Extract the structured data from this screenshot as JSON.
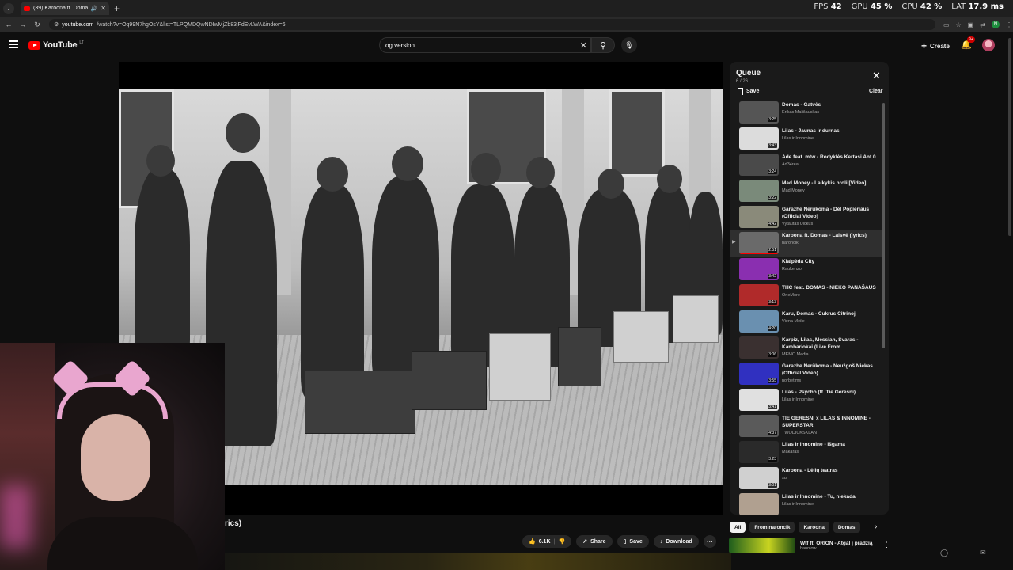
{
  "browser": {
    "tab_title": "(39) Karoona ft. Domas - Laisvė",
    "url_host": "youtube.com",
    "url_path": "/watch?v=Oq99N7hgOsY&list=TLPQMDQwNDIwMjZb83jFdEvLWA&index=6",
    "new_tab": "+"
  },
  "stats": {
    "fps_label": "FPS",
    "fps_value": "42",
    "gpu_label": "GPU",
    "gpu_value": "45 %",
    "cpu_label": "CPU",
    "cpu_value": "42 %",
    "lat_label": "LAT",
    "lat_value": "17.9 ms"
  },
  "youtube": {
    "logo_text": "YouTube",
    "region": "LT",
    "search_value": "og version",
    "create_label": "Create",
    "notifications_badge": "9+"
  },
  "video": {
    "title_fragment": "rics)"
  },
  "actions": {
    "like_count": "6.1K",
    "share_label": "Share",
    "save_label": "Save",
    "download_label": "Download"
  },
  "queue": {
    "title": "Queue",
    "position": "6 / 26",
    "save_label": "Save",
    "clear_label": "Clear",
    "items": [
      {
        "title": "Domas - Gatvės",
        "channel": "Erikas Mališauskas",
        "duration": "3:25",
        "thumb": "#555555",
        "progress": 0
      },
      {
        "title": "Lilas - Jaunas ir durnas",
        "channel": "Lilas ir Innomine",
        "duration": "3:43",
        "thumb": "#dcdcdc",
        "progress": 0
      },
      {
        "title": "Ade feat. mtw - Rodyklės Kertasi Ant 0",
        "channel": "Ad34real",
        "duration": "3:24",
        "thumb": "#4a4a4a",
        "progress": 0
      },
      {
        "title": "Mad Money - Laikykis broli [Video]",
        "channel": "Mad Money",
        "duration": "3:22",
        "thumb": "#7a8a7a",
        "progress": 0
      },
      {
        "title": "Garazhe Nerūkoma - Dėl Popieriaus (Official Video)",
        "channel": "Vytautas Ulckus",
        "duration": "4:42",
        "thumb": "#8a8a7a",
        "progress": 0
      },
      {
        "title": "Karoona ft. Domas - Laisvė (lyrics)",
        "channel": "naroncik",
        "duration": "2:51",
        "thumb": "#6a6a6a",
        "progress": 1
      },
      {
        "title": "Klaipėda City",
        "channel": "Raukenzo",
        "duration": "3:42",
        "thumb": "#8a2fb0",
        "progress": 0
      },
      {
        "title": "THC feat. DOMAS - NIEKO PANAŠAUS",
        "channel": "OneMore",
        "duration": "3:13",
        "thumb": "#b02a2a",
        "progress": 0
      },
      {
        "title": "Karu, Domas - Cukrus Citrinoj",
        "channel": "Viena Meile",
        "duration": "4:20",
        "thumb": "#6a90b0",
        "progress": 0
      },
      {
        "title": "Karpiz, Lilas, Messiah, Svaras - Kambariokai (Live From...",
        "channel": "MEMO Media",
        "duration": "3:06",
        "thumb": "#3a3030",
        "progress": 0
      },
      {
        "title": "Garazhe Nerūkoma - Neužgoš Niekas (Official Video)",
        "channel": "norbetims",
        "duration": "3:55",
        "thumb": "#3030c0",
        "progress": 0
      },
      {
        "title": "Lilas - Psycho (ft. Tie Geresni)",
        "channel": "Lilas ir Innomine",
        "duration": "3:41",
        "thumb": "#e0e0e0",
        "progress": 0
      },
      {
        "title": "TIE GERESNI x LILAS & INNOMINE - SUPERSTAR",
        "channel": "TWODICKSKLAN",
        "duration": "4:37",
        "thumb": "#5a5a5a",
        "progress": 0
      },
      {
        "title": "Lilas ir Innomine - Išgama",
        "channel": "Makaras",
        "duration": "3:23",
        "thumb": "#2a2a2a",
        "progress": 0
      },
      {
        "title": "Karoona - Lėlių teatras",
        "channel": "su",
        "duration": "3:01",
        "thumb": "#d0d0d0",
        "progress": 0
      },
      {
        "title": "Lilas ir Innomine - Tu, niekada",
        "channel": "Lilas ir Innomine",
        "duration": "",
        "thumb": "#b0a090",
        "progress": 0
      }
    ]
  },
  "chips": [
    "All",
    "From naroncik",
    "Karoona",
    "Domas"
  ],
  "recommendation": {
    "title": "Wtf ft. ORION - Atgal į pradžią",
    "channel": "banniow"
  }
}
